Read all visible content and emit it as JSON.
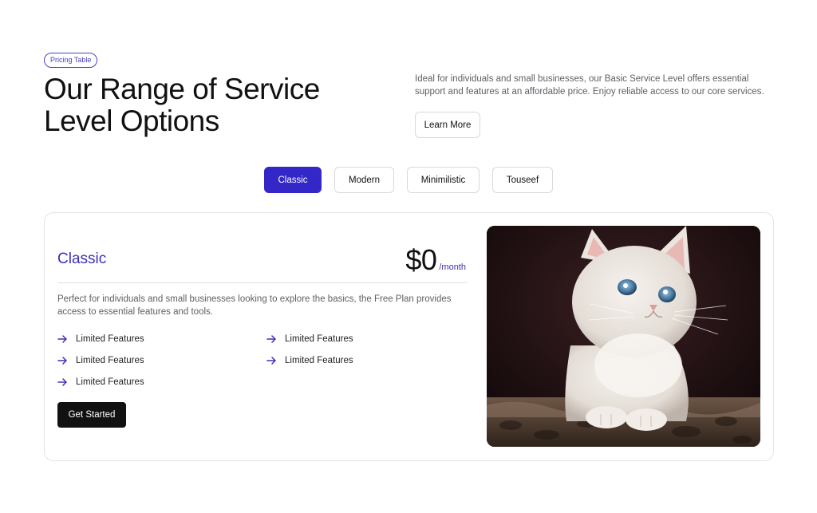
{
  "header": {
    "badge": "Pricing Table",
    "title": "Our Range of Service Level Options",
    "description": "Ideal for individuals and small businesses, our Basic Service Level offers essential support and features at an affordable price. Enjoy reliable access to our core services.",
    "learn_more_label": "Learn More"
  },
  "tabs": [
    {
      "label": "Classic",
      "active": true
    },
    {
      "label": "Modern",
      "active": false
    },
    {
      "label": "Minimilistic",
      "active": false
    },
    {
      "label": "Touseef",
      "active": false
    }
  ],
  "card": {
    "plan_name": "Classic",
    "price": "$0",
    "period": "/month",
    "description": "Perfect for individuals and small businesses looking to explore the basics, the Free Plan provides access to essential features and tools.",
    "features": [
      "Limited Features",
      "Limited Features",
      "Limited Features",
      "Limited Features",
      "Limited Features"
    ],
    "cta_label": "Get Started",
    "image": "kitten-photo"
  },
  "colors": {
    "accent": "#3427c8",
    "accent_text": "#3b30b9",
    "cta_bg": "#111111",
    "border": "#d9d9de"
  },
  "icons": {
    "feature_bullet": "arrow-right-icon"
  }
}
